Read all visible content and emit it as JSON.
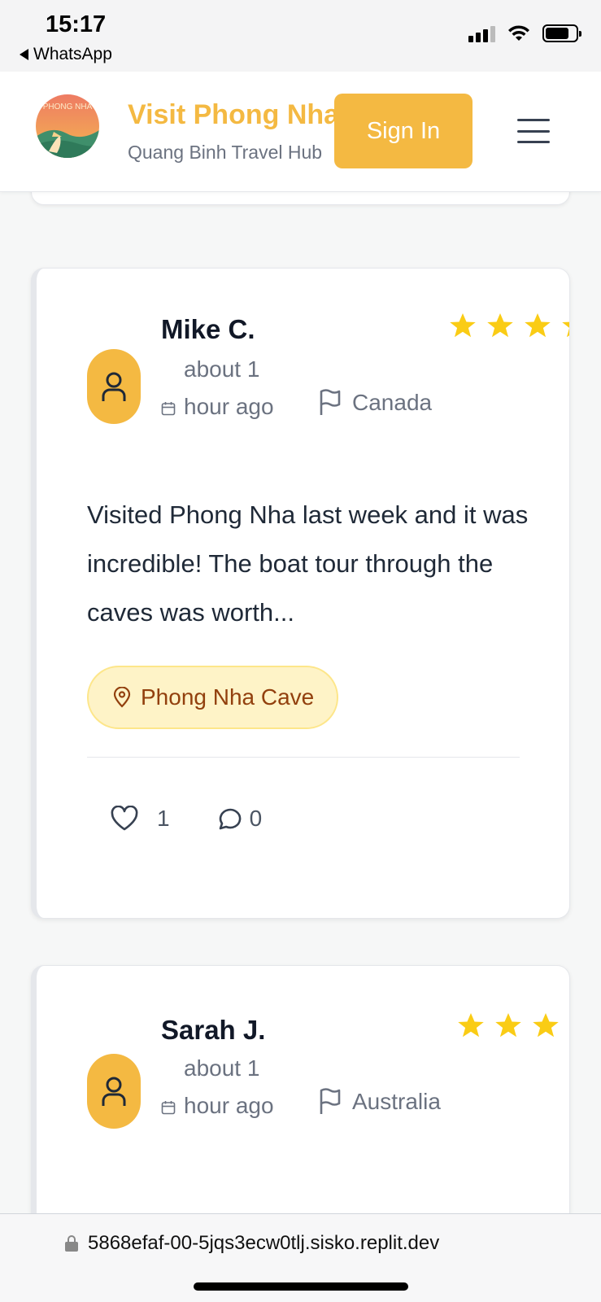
{
  "status_bar": {
    "time": "15:17",
    "back_app": "WhatsApp"
  },
  "header": {
    "logo_text": "PHONG NHA",
    "title": "Visit Phong Nha",
    "subtitle": "Quang Binh Travel Hub",
    "sign_in_label": "Sign In",
    "menu_icon": "hamburger-menu-icon"
  },
  "reviews": [
    {
      "name": "Mike C.",
      "time": "about 1 hour ago",
      "country": "Canada",
      "text": "Visited Phong Nha last week and it was incredible! The boat tour through the caves was worth...",
      "place": "Phong Nha Cave",
      "likes": "1",
      "comments": "0",
      "rating_stars_visible": 4
    },
    {
      "name": "Sarah J.",
      "time": "about 1 hour ago",
      "country": "Australia",
      "rating_stars_visible": 3
    }
  ],
  "browser": {
    "url": "5868efaf-00-5jqs3ecw0tlj.sisko.replit.dev"
  },
  "colors": {
    "accent": "#f4b942",
    "star": "#facc15",
    "tag_bg": "#fef3c7",
    "tag_text": "#92400e"
  }
}
